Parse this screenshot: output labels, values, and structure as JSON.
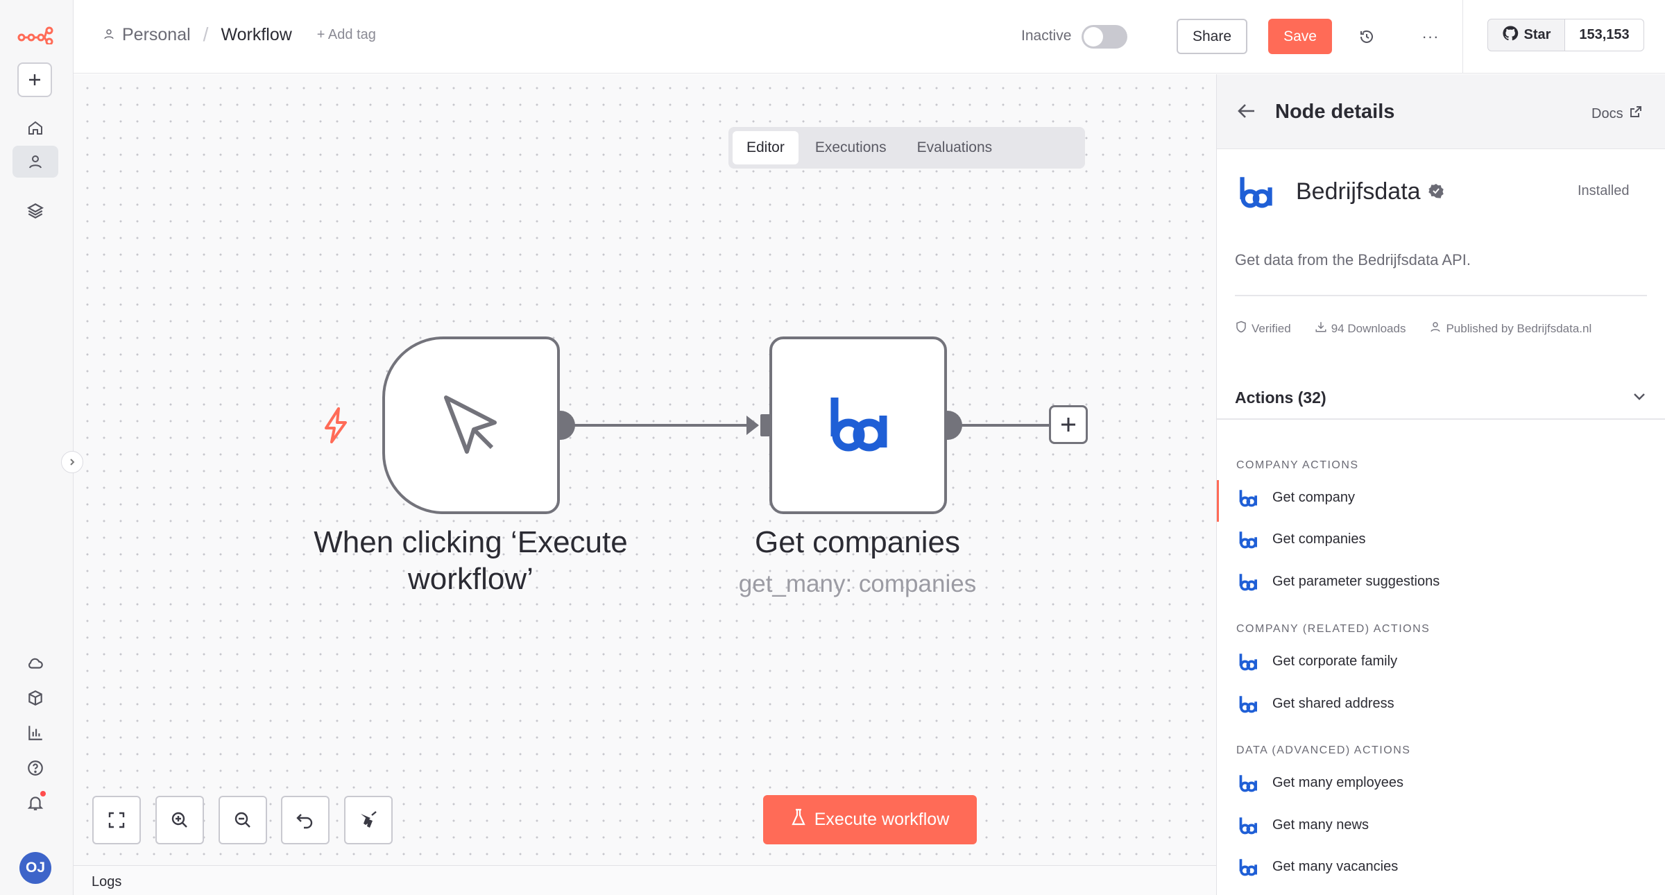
{
  "breadcrumb": {
    "project": "Personal",
    "separator": "/",
    "workflow": "Workflow",
    "add_tag": "+ Add tag"
  },
  "status": {
    "label": "Inactive",
    "active": false
  },
  "toolbar": {
    "share_label": "Share",
    "save_label": "Save",
    "more_label": "···"
  },
  "github": {
    "star_label": "Star",
    "star_count": "153,153"
  },
  "tabs": [
    {
      "label": "Editor",
      "active": true
    },
    {
      "label": "Executions",
      "active": false
    },
    {
      "label": "Evaluations",
      "active": false
    }
  ],
  "canvas": {
    "trigger_node": {
      "title": "When clicking ‘Execute workflow’",
      "icon": "cursor-pointer-icon"
    },
    "action_node": {
      "title": "Get companies",
      "subtitle": "get_many: companies",
      "icon": "bedrijfsdata-logo"
    },
    "execute_label": "Execute workflow",
    "controls": [
      "fit-view-icon",
      "zoom-in-icon",
      "zoom-out-icon",
      "undo-icon",
      "tidy-up-icon"
    ]
  },
  "logs": {
    "label": "Logs"
  },
  "avatar": {
    "initials": "OJ"
  },
  "panel": {
    "title": "Node details",
    "docs_label": "Docs",
    "node_name": "Bedrijfsdata",
    "installed_label": "Installed",
    "description": "Get data from the Bedrijfsdata API.",
    "meta": {
      "verified": "Verified",
      "downloads": "94 Downloads",
      "publisher": "Published by Bedrijfsdata.nl"
    },
    "actions_title": "Actions (32)",
    "sections": [
      {
        "label": "COMPANY ACTIONS",
        "items": [
          "Get company",
          "Get companies",
          "Get parameter suggestions"
        ]
      },
      {
        "label": "COMPANY (RELATED) ACTIONS",
        "items": [
          "Get corporate family",
          "Get shared address"
        ]
      },
      {
        "label": "DATA (ADVANCED) ACTIONS",
        "items": [
          "Get many employees",
          "Get many news",
          "Get many vacancies"
        ]
      }
    ]
  },
  "colors": {
    "accent": "#ff6b57",
    "brand_blue": "#1f5fd6",
    "node_border": "#73737b"
  }
}
